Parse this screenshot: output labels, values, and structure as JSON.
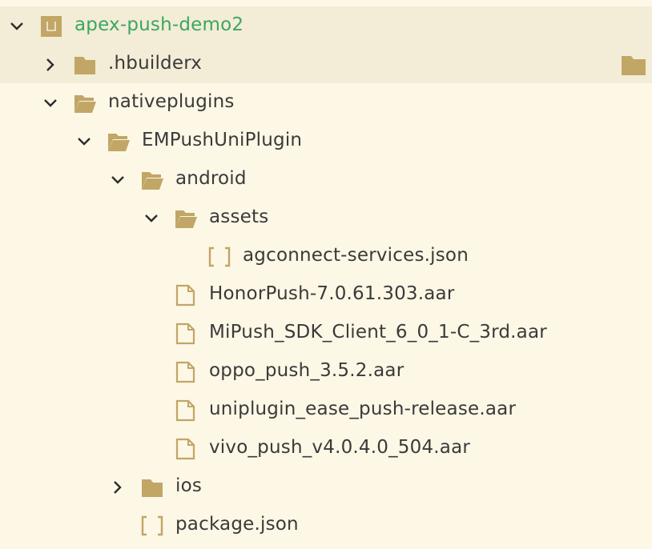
{
  "colors": {
    "background": "#fdf7e6",
    "highlight": "#f3ecd7",
    "icon": "#c1a666",
    "root_label": "#3ba75f",
    "text": "#3a3a38"
  },
  "tree": [
    {
      "label": "apex-push-demo2",
      "depth": 0,
      "icon": "project-icon",
      "chevron": "down",
      "root": true
    },
    {
      "label": ".hbuilderx",
      "depth": 1,
      "icon": "folder-closed-icon",
      "chevron": "right"
    },
    {
      "label": "nativeplugins",
      "depth": 1,
      "icon": "folder-open-icon",
      "chevron": "down"
    },
    {
      "label": "EMPushUniPlugin",
      "depth": 2,
      "icon": "folder-open-icon",
      "chevron": "down"
    },
    {
      "label": "android",
      "depth": 3,
      "icon": "folder-open-icon",
      "chevron": "down"
    },
    {
      "label": "assets",
      "depth": 4,
      "icon": "folder-open-icon",
      "chevron": "down"
    },
    {
      "label": "agconnect-services.json",
      "depth": 5,
      "icon": "json-file-icon"
    },
    {
      "label": "HonorPush-7.0.61.303.aar",
      "depth": 4,
      "icon": "file-icon"
    },
    {
      "label": "MiPush_SDK_Client_6_0_1-C_3rd.aar",
      "depth": 4,
      "icon": "file-icon"
    },
    {
      "label": "oppo_push_3.5.2.aar",
      "depth": 4,
      "icon": "file-icon"
    },
    {
      "label": "uniplugin_ease_push-release.aar",
      "depth": 4,
      "icon": "file-icon"
    },
    {
      "label": "vivo_push_v4.0.4.0_504.aar",
      "depth": 4,
      "icon": "file-icon"
    },
    {
      "label": "ios",
      "depth": 3,
      "icon": "folder-closed-icon",
      "chevron": "right"
    },
    {
      "label": "package.json",
      "depth": 3,
      "icon": "json-file-icon"
    }
  ]
}
